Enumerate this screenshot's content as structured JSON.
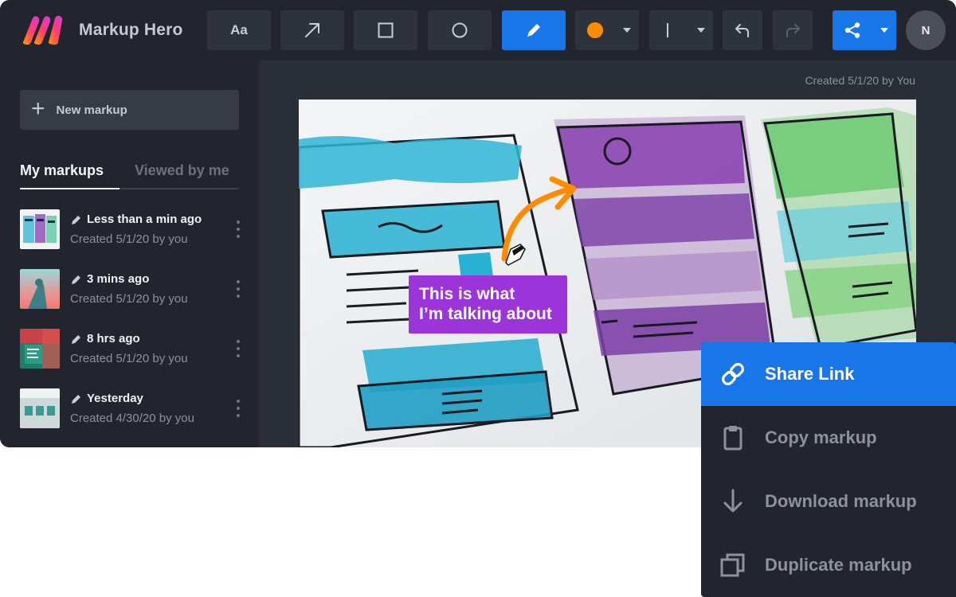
{
  "app": {
    "name": "Markup Hero"
  },
  "toolbar": {
    "text_tool_label": "Aa",
    "color_swatch": "#ff8c00",
    "user_initial": "N"
  },
  "colors": {
    "accent": "#1976e8",
    "callout": "#9b34d9",
    "arrow": "#ff8c00"
  },
  "sidebar": {
    "new_markup_label": "New markup",
    "tabs": [
      {
        "label": "My markups",
        "active": true
      },
      {
        "label": "Viewed by me",
        "active": false
      }
    ],
    "items": [
      {
        "title": "Less than a min ago",
        "subtitle": "Created 5/1/20 by you"
      },
      {
        "title": "3 mins ago",
        "subtitle": "Created 5/1/20 by you"
      },
      {
        "title": "8 hrs ago",
        "subtitle": "Created 5/1/20 by you"
      },
      {
        "title": "Yesterday",
        "subtitle": "Created 4/30/20 by you"
      }
    ]
  },
  "main": {
    "created_label": "Created 5/1/20 by You",
    "callout_text": "This is what\nI’m talking about"
  },
  "share_menu": {
    "items": [
      {
        "label": "Share Link",
        "icon": "link-icon"
      },
      {
        "label": "Copy markup",
        "icon": "clipboard-icon"
      },
      {
        "label": "Download markup",
        "icon": "download-icon"
      },
      {
        "label": "Duplicate markup",
        "icon": "duplicate-icon"
      }
    ]
  }
}
